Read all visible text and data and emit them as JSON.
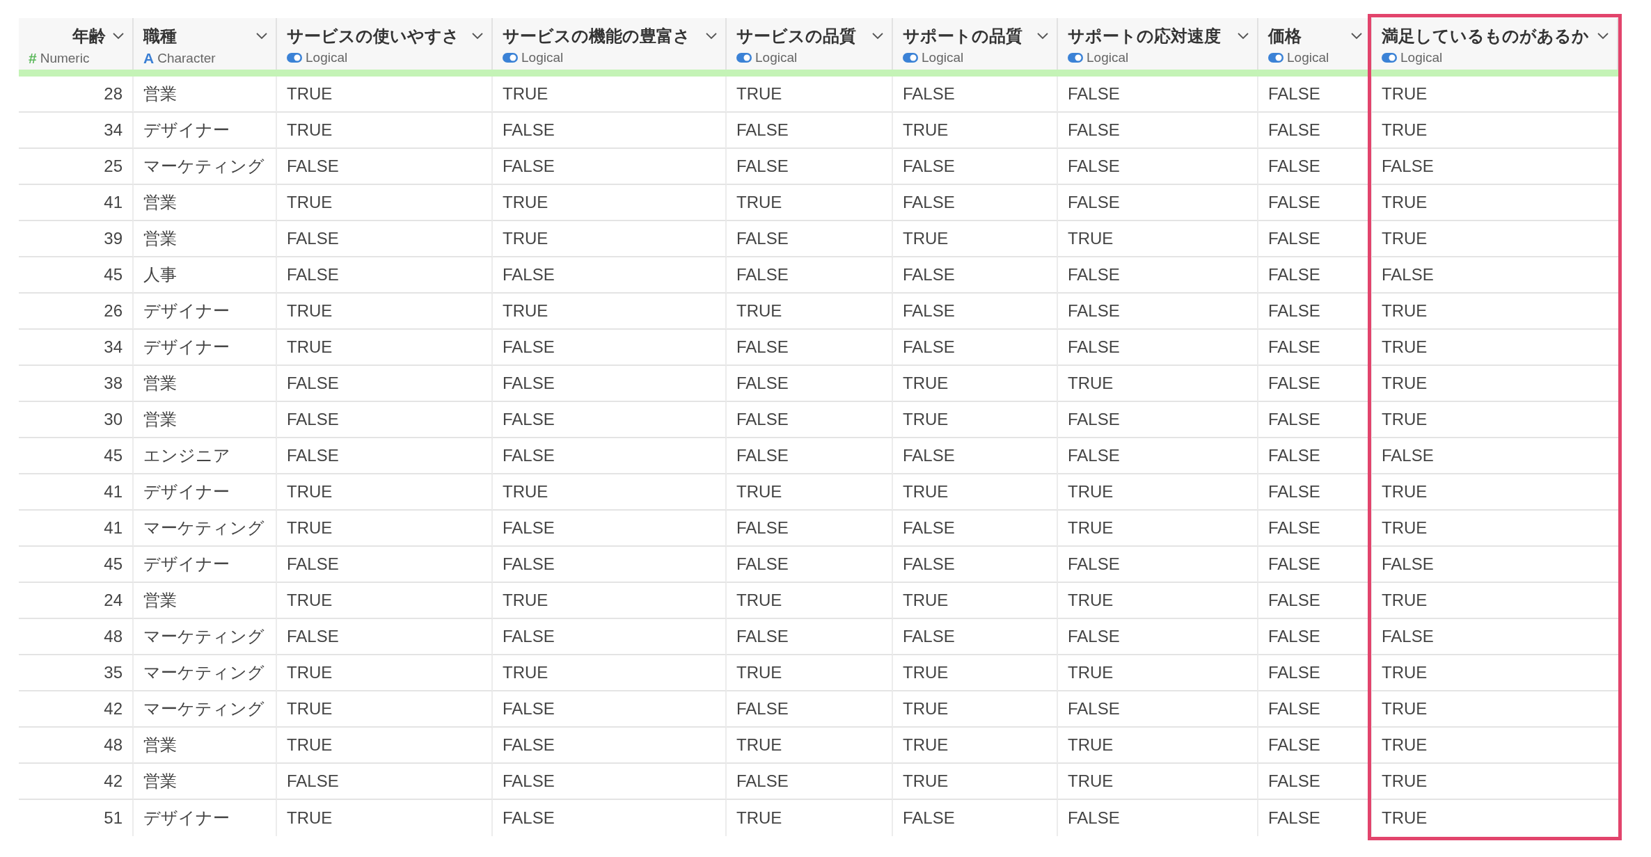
{
  "table": {
    "columns": [
      {
        "name": "年齢",
        "kind": "numeric",
        "type_icon": "#",
        "type_label": "Numeric",
        "highlighted": false
      },
      {
        "name": "職種",
        "kind": "character",
        "type_icon": "A",
        "type_label": "Character",
        "highlighted": false
      },
      {
        "name": "サービスの使いやすさ",
        "kind": "logical",
        "type_label": "Logical",
        "highlighted": false
      },
      {
        "name": "サービスの機能の豊富さ",
        "kind": "logical",
        "type_label": "Logical",
        "highlighted": false
      },
      {
        "name": "サービスの品質",
        "kind": "logical",
        "type_label": "Logical",
        "highlighted": false
      },
      {
        "name": "サポートの品質",
        "kind": "logical",
        "type_label": "Logical",
        "highlighted": false
      },
      {
        "name": "サポートの応対速度",
        "kind": "logical",
        "type_label": "Logical",
        "highlighted": false
      },
      {
        "name": "価格",
        "kind": "logical",
        "type_label": "Logical",
        "highlighted": false
      },
      {
        "name": "満足しているものがあるか",
        "kind": "logical",
        "type_label": "Logical",
        "highlighted": true
      }
    ],
    "rows": [
      [
        "28",
        "営業",
        "TRUE",
        "TRUE",
        "TRUE",
        "FALSE",
        "FALSE",
        "FALSE",
        "TRUE"
      ],
      [
        "34",
        "デザイナー",
        "TRUE",
        "FALSE",
        "FALSE",
        "TRUE",
        "FALSE",
        "FALSE",
        "TRUE"
      ],
      [
        "25",
        "マーケティング",
        "FALSE",
        "FALSE",
        "FALSE",
        "FALSE",
        "FALSE",
        "FALSE",
        "FALSE"
      ],
      [
        "41",
        "営業",
        "TRUE",
        "TRUE",
        "TRUE",
        "FALSE",
        "FALSE",
        "FALSE",
        "TRUE"
      ],
      [
        "39",
        "営業",
        "FALSE",
        "TRUE",
        "FALSE",
        "TRUE",
        "TRUE",
        "FALSE",
        "TRUE"
      ],
      [
        "45",
        "人事",
        "FALSE",
        "FALSE",
        "FALSE",
        "FALSE",
        "FALSE",
        "FALSE",
        "FALSE"
      ],
      [
        "26",
        "デザイナー",
        "TRUE",
        "TRUE",
        "TRUE",
        "FALSE",
        "FALSE",
        "FALSE",
        "TRUE"
      ],
      [
        "34",
        "デザイナー",
        "TRUE",
        "FALSE",
        "FALSE",
        "FALSE",
        "FALSE",
        "FALSE",
        "TRUE"
      ],
      [
        "38",
        "営業",
        "FALSE",
        "FALSE",
        "FALSE",
        "TRUE",
        "TRUE",
        "FALSE",
        "TRUE"
      ],
      [
        "30",
        "営業",
        "FALSE",
        "FALSE",
        "FALSE",
        "TRUE",
        "FALSE",
        "FALSE",
        "TRUE"
      ],
      [
        "45",
        "エンジニア",
        "FALSE",
        "FALSE",
        "FALSE",
        "FALSE",
        "FALSE",
        "FALSE",
        "FALSE"
      ],
      [
        "41",
        "デザイナー",
        "TRUE",
        "TRUE",
        "TRUE",
        "TRUE",
        "TRUE",
        "FALSE",
        "TRUE"
      ],
      [
        "41",
        "マーケティング",
        "TRUE",
        "FALSE",
        "FALSE",
        "FALSE",
        "TRUE",
        "FALSE",
        "TRUE"
      ],
      [
        "45",
        "デザイナー",
        "FALSE",
        "FALSE",
        "FALSE",
        "FALSE",
        "FALSE",
        "FALSE",
        "FALSE"
      ],
      [
        "24",
        "営業",
        "TRUE",
        "TRUE",
        "TRUE",
        "TRUE",
        "TRUE",
        "FALSE",
        "TRUE"
      ],
      [
        "48",
        "マーケティング",
        "FALSE",
        "FALSE",
        "FALSE",
        "FALSE",
        "FALSE",
        "FALSE",
        "FALSE"
      ],
      [
        "35",
        "マーケティング",
        "TRUE",
        "TRUE",
        "TRUE",
        "TRUE",
        "TRUE",
        "FALSE",
        "TRUE"
      ],
      [
        "42",
        "マーケティング",
        "TRUE",
        "FALSE",
        "FALSE",
        "TRUE",
        "FALSE",
        "FALSE",
        "TRUE"
      ],
      [
        "48",
        "営業",
        "TRUE",
        "FALSE",
        "TRUE",
        "TRUE",
        "TRUE",
        "FALSE",
        "TRUE"
      ],
      [
        "42",
        "営業",
        "FALSE",
        "FALSE",
        "FALSE",
        "TRUE",
        "TRUE",
        "FALSE",
        "TRUE"
      ],
      [
        "51",
        "デザイナー",
        "TRUE",
        "FALSE",
        "TRUE",
        "FALSE",
        "FALSE",
        "FALSE",
        "TRUE"
      ]
    ]
  }
}
